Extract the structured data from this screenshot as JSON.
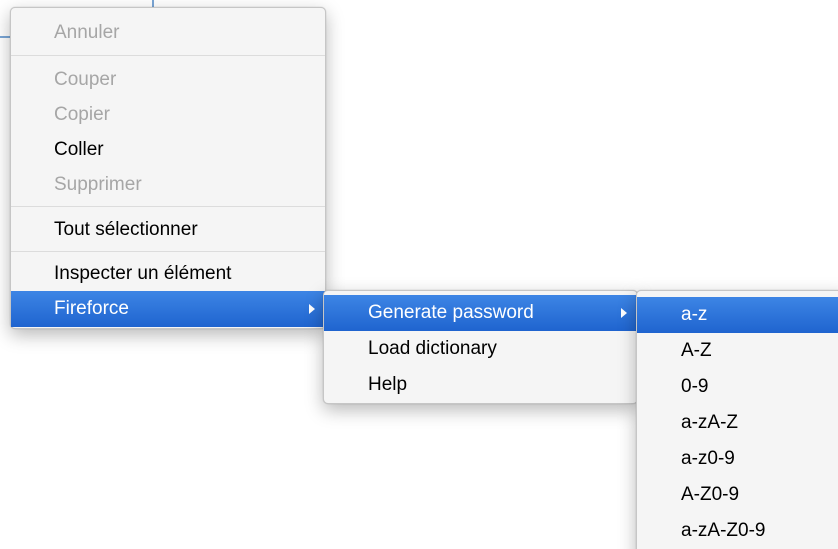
{
  "main_menu": {
    "items": [
      {
        "label": "Annuler",
        "enabled": false
      },
      {
        "label": "Couper",
        "enabled": false
      },
      {
        "label": "Copier",
        "enabled": false
      },
      {
        "label": "Coller",
        "enabled": true
      },
      {
        "label": "Supprimer",
        "enabled": false
      },
      {
        "label": "Tout sélectionner",
        "enabled": true
      },
      {
        "label": "Inspecter un élément",
        "enabled": true
      },
      {
        "label": "Fireforce",
        "enabled": true,
        "highlighted": true,
        "has_submenu": true
      }
    ]
  },
  "fireforce_menu": {
    "items": [
      {
        "label": "Generate password",
        "highlighted": true,
        "has_submenu": true
      },
      {
        "label": "Load dictionary"
      },
      {
        "label": "Help"
      }
    ]
  },
  "password_menu": {
    "items": [
      {
        "label": "a-z",
        "highlighted": true
      },
      {
        "label": "A-Z"
      },
      {
        "label": "0-9"
      },
      {
        "label": "a-zA-Z"
      },
      {
        "label": "a-z0-9"
      },
      {
        "label": "A-Z0-9"
      },
      {
        "label": "a-zA-Z0-9"
      }
    ]
  },
  "colors": {
    "highlight": "#2a6fd3",
    "menu_background": "#f5f5f5",
    "disabled_text": "#a6a6a6"
  },
  "icons": {
    "submenu_arrow": "chevron-right-icon"
  }
}
